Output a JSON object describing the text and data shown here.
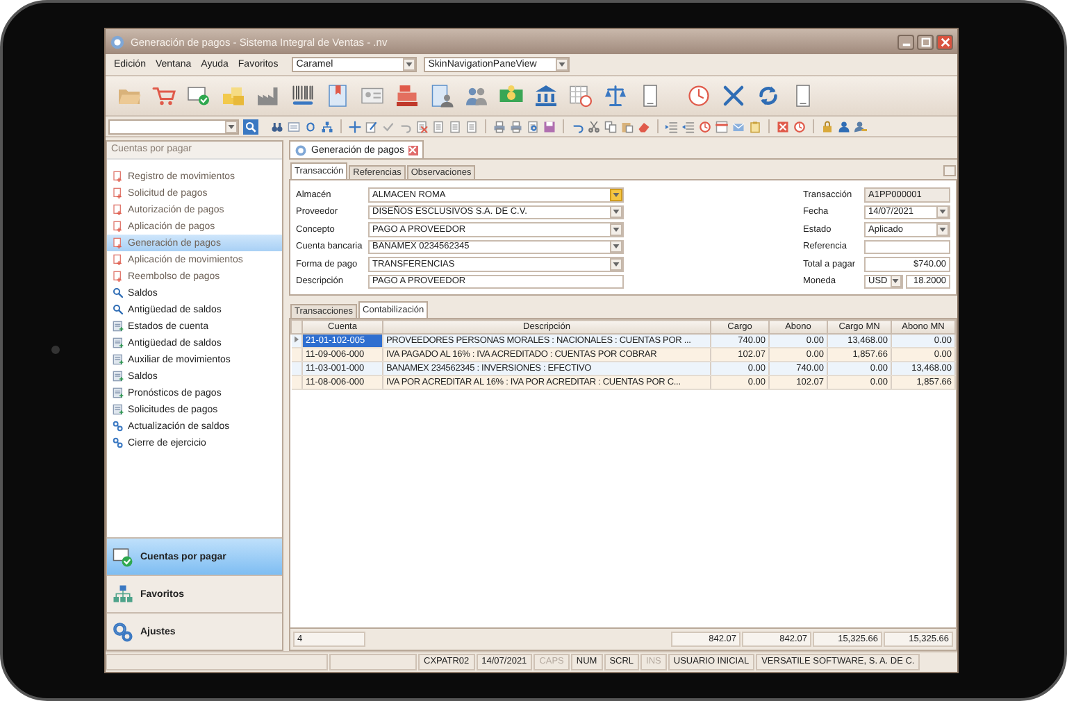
{
  "window": {
    "title": "Generación de pagos - Sistema Integral de Ventas - .nv"
  },
  "menu": [
    "Edición",
    "Ventana",
    "Ayuda",
    "Favoritos"
  ],
  "skin_selector": {
    "value": "Caramel"
  },
  "view_selector": {
    "value": "SkinNavigationPaneView"
  },
  "sidebar": {
    "header": "Cuentas por pagar",
    "items": [
      {
        "label": "Registro de movimientos",
        "kind": "document",
        "selected": false
      },
      {
        "label": "Solicitud de pagos",
        "kind": "document",
        "selected": false
      },
      {
        "label": "Autorización de pagos",
        "kind": "document",
        "selected": false
      },
      {
        "label": "Aplicación de pagos",
        "kind": "document",
        "selected": false
      },
      {
        "label": "Generación de pagos",
        "kind": "document",
        "selected": true
      },
      {
        "label": "Aplicación de movimientos",
        "kind": "document",
        "selected": false
      },
      {
        "label": "Reembolso de pagos",
        "kind": "document",
        "selected": false
      },
      {
        "label": "Saldos",
        "kind": "search",
        "selected": false
      },
      {
        "label": "Antigüedad de saldos",
        "kind": "search",
        "selected": false
      },
      {
        "label": "Estados de cuenta",
        "kind": "report",
        "selected": false
      },
      {
        "label": "Antigüedad de saldos",
        "kind": "report",
        "selected": false
      },
      {
        "label": "Auxiliar de movimientos",
        "kind": "report",
        "selected": false
      },
      {
        "label": "Saldos",
        "kind": "report",
        "selected": false
      },
      {
        "label": "Pronósticos de pagos",
        "kind": "report",
        "selected": false
      },
      {
        "label": "Solicitudes de pagos",
        "kind": "report",
        "selected": false
      },
      {
        "label": "Actualización de saldos",
        "kind": "link",
        "selected": false
      },
      {
        "label": "Cierre de ejercicio",
        "kind": "link",
        "selected": false
      }
    ],
    "panes": [
      {
        "label": "Cuentas por pagar",
        "kind": "accounts",
        "selected": true
      },
      {
        "label": "Favoritos",
        "kind": "favorites",
        "selected": false
      },
      {
        "label": "Ajustes",
        "kind": "settings",
        "selected": false
      }
    ]
  },
  "document_tab": {
    "label": "Generación de pagos"
  },
  "form_tabs": [
    {
      "label": "Transacción",
      "selected": true
    },
    {
      "label": "Referencias",
      "selected": false
    },
    {
      "label": "Observaciones",
      "selected": false
    }
  ],
  "form": {
    "left": [
      {
        "label": "Almacén",
        "value": "ALMACEN ROMA",
        "kind": "combo",
        "focused": true
      },
      {
        "label": "Proveedor",
        "value": "DISEÑOS ESCLUSIVOS S.A. DE C.V.",
        "kind": "combo",
        "focused": false
      },
      {
        "label": "Concepto",
        "value": "PAGO A PROVEEDOR",
        "kind": "combo",
        "focused": false
      },
      {
        "label": "Cuenta bancaria",
        "value": "BANAMEX 0234562345",
        "kind": "combo",
        "focused": false
      },
      {
        "label": "Forma de pago",
        "value": "TRANSFERENCIAS",
        "kind": "combo",
        "focused": false
      },
      {
        "label": "Descripción",
        "value": "PAGO A PROVEEDOR",
        "kind": "text",
        "focused": false
      }
    ],
    "right": [
      {
        "label": "Transacción",
        "value": "A1PP000001",
        "kind": "readonly"
      },
      {
        "label": "Fecha",
        "value": "14/07/2021",
        "kind": "combo"
      },
      {
        "label": "Estado",
        "value": "Aplicado",
        "kind": "combo"
      },
      {
        "label": "Referencia",
        "kind": "text"
      },
      {
        "label": "Total a pagar",
        "value": "$740.00",
        "kind": "amount"
      },
      {
        "label": "Moneda",
        "value": "USD",
        "rate": "18.2000",
        "kind": "currency"
      }
    ]
  },
  "grid_tabs": [
    {
      "label": "Transacciones",
      "selected": false
    },
    {
      "label": "Contabilización",
      "selected": true
    }
  ],
  "grid": {
    "columns": [
      "Cuenta",
      "Descripción",
      "Cargo",
      "Abono",
      "Cargo MN",
      "Abono MN"
    ],
    "rows": [
      {
        "selected": true,
        "cells": [
          "21-01-102-005",
          "PROVEEDORES PERSONAS MORALES : NACIONALES : CUENTAS POR ...",
          "740.00",
          "0.00",
          "13,468.00",
          "0.00"
        ]
      },
      {
        "selected": false,
        "cells": [
          "11-09-006-000",
          "IVA PAGADO AL 16% : IVA ACREDITADO : CUENTAS POR COBRAR",
          "102.07",
          "0.00",
          "1,857.66",
          "0.00"
        ]
      },
      {
        "selected": false,
        "cells": [
          "11-03-001-000",
          "BANAMEX 234562345 : INVERSIONES : EFECTIVO",
          "0.00",
          "740.00",
          "0.00",
          "13,468.00"
        ]
      },
      {
        "selected": false,
        "cells": [
          "11-08-006-000",
          "IVA POR ACREDITAR AL 16% : IVA POR ACREDITAR : CUENTAS POR C...",
          "0.00",
          "102.07",
          "0.00",
          "1,857.66"
        ]
      }
    ],
    "footer": {
      "count": "4",
      "totals": [
        "842.07",
        "842.07",
        "15,325.66",
        "15,325.66"
      ]
    }
  },
  "status_bar": [
    {
      "text": "CXPATR02",
      "disabled": false
    },
    {
      "text": "14/07/2021",
      "disabled": false
    },
    {
      "text": "CAPS",
      "disabled": true
    },
    {
      "text": "NUM",
      "disabled": false
    },
    {
      "text": "SCRL",
      "disabled": false
    },
    {
      "text": "INS",
      "disabled": true
    },
    {
      "text": "USUARIO INICIAL",
      "disabled": false
    },
    {
      "text": "VERSATILE SOFTWARE, S. A. DE C.",
      "disabled": false
    }
  ]
}
